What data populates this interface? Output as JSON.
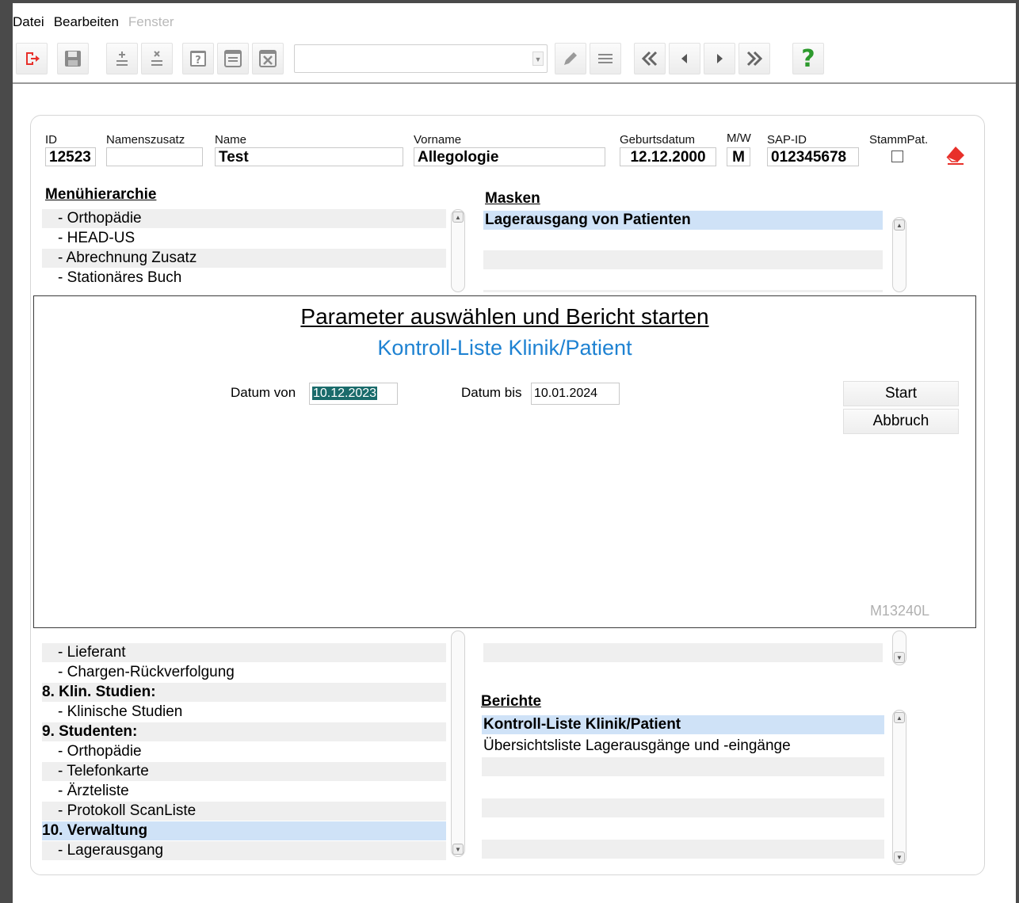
{
  "menubar": {
    "file": "Datei",
    "edit": "Bearbeiten",
    "window": "Fenster"
  },
  "colors": {
    "accent_blue": "#1e82d2",
    "selection": "#cfe2f7",
    "help_green": "#2d9a2d",
    "exit_red": "#e8302a"
  },
  "patient": {
    "id_label": "ID",
    "id_value": "12523",
    "name_suffix_label": "Namenszusatz",
    "name_suffix_value": "",
    "name_label": "Name",
    "name_value": "Test",
    "firstname_label": "Vorname",
    "firstname_value": "Allegologie",
    "birth_label": "Geburtsdatum",
    "birth_value": "12.12.2000",
    "gender_label": "M/W",
    "gender_value": "M",
    "sap_label": "SAP-ID",
    "sap_value": "012345678",
    "stamm_label": "StammPat."
  },
  "menu_hierarchy": {
    "title": "Menühierarchie",
    "top_items": [
      "- Orthopädie",
      "- HEAD-US",
      "- Abrechnung Zusatz",
      "- Stationäres Buch"
    ],
    "bottom_items": [
      {
        "text": "- Lieferant",
        "bold": false,
        "indent": true
      },
      {
        "text": "- Chargen-Rückverfolgung",
        "bold": false,
        "indent": true
      },
      {
        "text": "8. Klin. Studien:",
        "bold": true,
        "indent": false
      },
      {
        "text": "- Klinische Studien",
        "bold": false,
        "indent": true
      },
      {
        "text": "9. Studenten:",
        "bold": true,
        "indent": false
      },
      {
        "text": "- Orthopädie",
        "bold": false,
        "indent": true
      },
      {
        "text": "- Telefonkarte",
        "bold": false,
        "indent": true
      },
      {
        "text": "- Ärzteliste",
        "bold": false,
        "indent": true
      },
      {
        "text": "- Protokoll ScanListe",
        "bold": false,
        "indent": true
      },
      {
        "text": "10. Verwaltung",
        "bold": true,
        "indent": false
      },
      {
        "text": "- Lagerausgang",
        "bold": false,
        "indent": true
      }
    ]
  },
  "masks": {
    "title": "Masken",
    "items": [
      "Lagerausgang von Patienten"
    ]
  },
  "reports": {
    "title": "Berichte",
    "items": [
      "Kontroll-Liste Klinik/Patient",
      "Übersichtsliste Lagerausgänge und -eingänge"
    ]
  },
  "dialog": {
    "title": "Parameter auswählen und Bericht starten",
    "subtitle": "Kontroll-Liste Klinik/Patient",
    "date_from_label": "Datum von",
    "date_from_value": "10.12.2023",
    "date_to_label": "Datum bis",
    "date_to_value": "10.01.2024",
    "start_label": "Start",
    "cancel_label": "Abbruch",
    "mask_code": "M13240L"
  }
}
